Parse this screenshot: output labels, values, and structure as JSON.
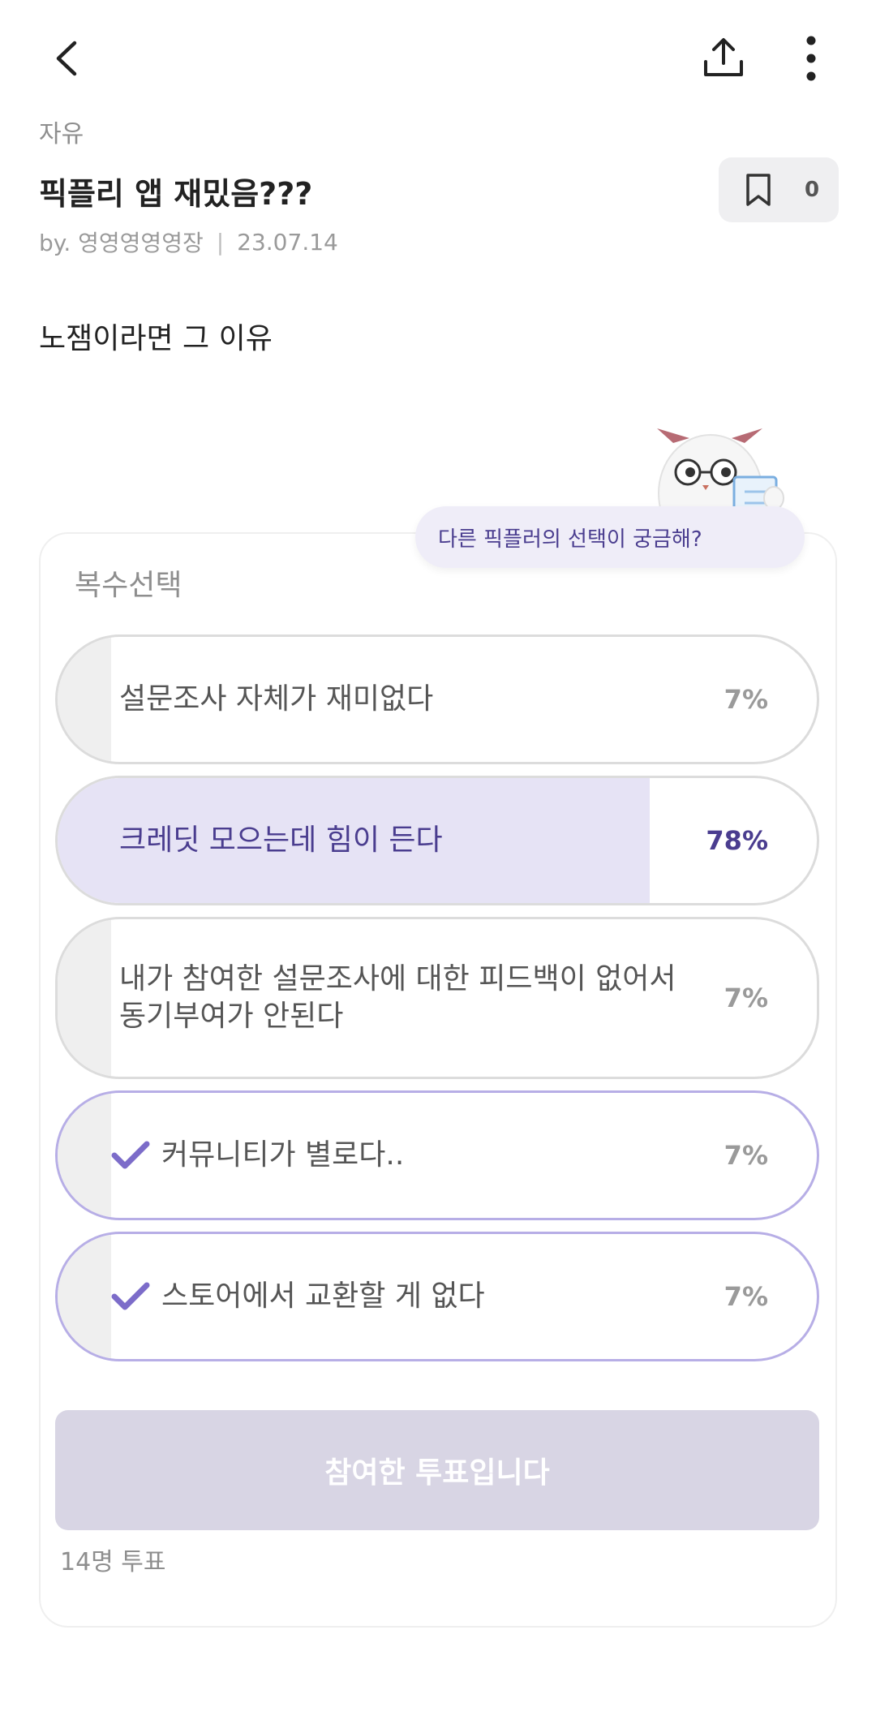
{
  "header": {
    "back_icon": "chevron-left-icon",
    "share_icon": "upload-share-icon",
    "more_icon": "more-vertical-icon"
  },
  "post": {
    "category": "자유",
    "title": "픽플리 앱 재밌음???",
    "author": "by. 영영영영영장",
    "separator": "|",
    "date": "23.07.14",
    "bookmark_count": "0",
    "body": "노잼이라면 그 이유"
  },
  "tooltip": {
    "text": "다른 픽플러의 선택이 궁금해?"
  },
  "poll": {
    "type": "복수선택",
    "options": [
      {
        "label": "설문조사 자체가 재미없다",
        "percent": "7%",
        "fill": 0.07,
        "voted": false,
        "winner": false
      },
      {
        "label": "크레딧 모으는데 힘이 든다",
        "percent": "78%",
        "fill": 0.78,
        "voted": false,
        "winner": true
      },
      {
        "label": "내가 참여한 설문조사에 대한 피드백이 없어서 동기부여가 안된다",
        "percent": "7%",
        "fill": 0.07,
        "voted": false,
        "winner": false
      },
      {
        "label": "커뮤니티가 별로다..",
        "percent": "7%",
        "fill": 0.07,
        "voted": true,
        "winner": false
      },
      {
        "label": "스토어에서 교환할 게 없다",
        "percent": "7%",
        "fill": 0.07,
        "voted": true,
        "winner": false
      }
    ],
    "submit_label": "참여한 투표입니다",
    "vote_count": "14명 투표"
  },
  "colors": {
    "accent": "#4a3d8f",
    "accent_light": "#e6e3f5",
    "voted_border": "#b7aee6",
    "check": "#7c6cc9",
    "button_disabled": "#d8d5e4"
  }
}
